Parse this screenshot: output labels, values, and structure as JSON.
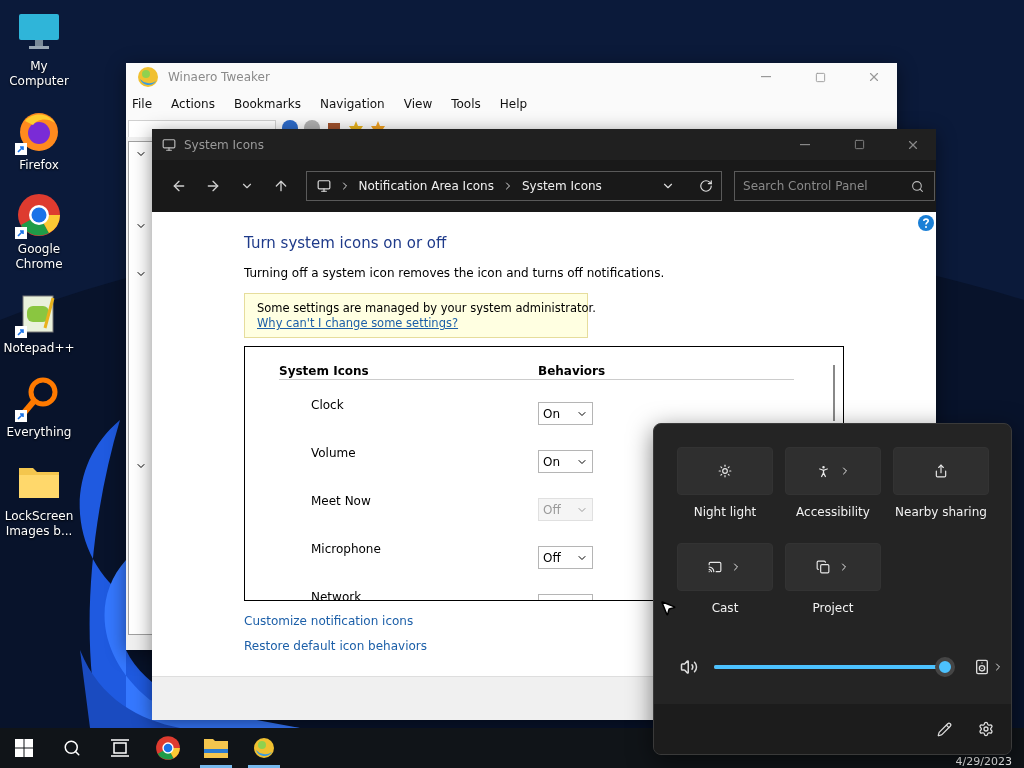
{
  "desktop_icons": [
    {
      "label": "My Computer",
      "kind": "computer",
      "shortcut": false
    },
    {
      "label": "Firefox",
      "kind": "firefox",
      "shortcut": true
    },
    {
      "label": "Google Chrome",
      "kind": "chrome",
      "shortcut": true
    },
    {
      "label": "Notepad++",
      "kind": "notepad",
      "shortcut": true
    },
    {
      "label": "Everything",
      "kind": "everything",
      "shortcut": true
    },
    {
      "label": "LockScreen Images b...",
      "kind": "folder",
      "shortcut": false
    }
  ],
  "tweaker_window": {
    "title": "Winaero Tweaker",
    "menu": [
      "File",
      "Actions",
      "Bookmarks",
      "Navigation",
      "View",
      "Tools",
      "Help"
    ]
  },
  "control_panel": {
    "title": "System Icons",
    "breadcrumb": [
      "Notification Area Icons",
      "System Icons"
    ],
    "search": {
      "placeholder": "Search Control Panel"
    },
    "heading": "Turn system icons on or off",
    "description": "Turning off a system icon removes the icon and turns off notifications.",
    "notice": {
      "text": "Some settings are managed by your system administrator.",
      "link": "Why can't I change some settings?"
    },
    "table": {
      "columns": [
        "System Icons",
        "Behaviors"
      ],
      "rows": [
        {
          "name": "Clock",
          "value": "On",
          "disabled": false
        },
        {
          "name": "Volume",
          "value": "On",
          "disabled": false
        },
        {
          "name": "Meet Now",
          "value": "Off",
          "disabled": true
        },
        {
          "name": "Microphone",
          "value": "Off",
          "disabled": false
        },
        {
          "name": "Network",
          "disabled": false
        }
      ]
    },
    "links": [
      "Customize notification icons",
      "Restore default icon behaviors"
    ]
  },
  "quick_settings": {
    "tiles": [
      {
        "label": "Night light",
        "kind": "night-light",
        "has_menu": false
      },
      {
        "label": "Accessibility",
        "kind": "accessibility",
        "has_menu": true
      },
      {
        "label": "Nearby sharing",
        "kind": "sharing",
        "has_menu": false
      },
      {
        "label": "Cast",
        "kind": "cast",
        "has_menu": true
      },
      {
        "label": "Project",
        "kind": "project",
        "has_menu": true
      }
    ],
    "volume": {
      "level": 1
    }
  },
  "taskbar": {
    "items": [
      {
        "kind": "start",
        "running": false
      },
      {
        "kind": "search",
        "running": false
      },
      {
        "kind": "task-view",
        "running": false
      },
      {
        "kind": "chrome",
        "running": false
      },
      {
        "kind": "explorer",
        "running": true
      },
      {
        "kind": "tweaker",
        "running": true
      }
    ],
    "date": "4/29/2023"
  }
}
